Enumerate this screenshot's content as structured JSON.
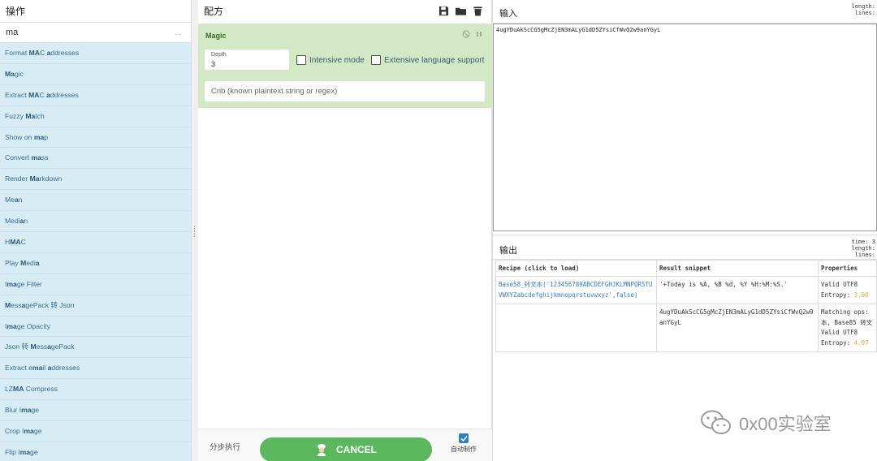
{
  "operations": {
    "title": "操作",
    "search_value": "ma",
    "search_dots": ". .",
    "items": [
      {
        "pre": "Format ",
        "hl": "MA",
        "mid": "C ",
        "hl2": "a",
        "post": "ddresses"
      },
      {
        "pre": "",
        "hl": "Ma",
        "mid": "gic",
        "hl2": "",
        "post": ""
      },
      {
        "pre": "Extract ",
        "hl": "MA",
        "mid": "C ",
        "hl2": "a",
        "post": "ddresses"
      },
      {
        "pre": "Fuzzy ",
        "hl": "Ma",
        "mid": "tch",
        "hl2": "",
        "post": ""
      },
      {
        "pre": "Show on ",
        "hl": "ma",
        "mid": "p",
        "hl2": "",
        "post": ""
      },
      {
        "pre": "Convert ",
        "hl": "ma",
        "mid": "ss",
        "hl2": "",
        "post": ""
      },
      {
        "pre": "Render ",
        "hl": "Ma",
        "mid": "rkdown",
        "hl2": "",
        "post": ""
      },
      {
        "pre": "Me",
        "hl": "a",
        "mid": "n",
        "hl2": "",
        "post": ""
      },
      {
        "pre": "Medi",
        "hl": "a",
        "mid": "n",
        "hl2": "",
        "post": ""
      },
      {
        "pre": "H",
        "hl": "MA",
        "mid": "C",
        "hl2": "",
        "post": ""
      },
      {
        "pre": "Play ",
        "hl": "M",
        "mid": "edi",
        "hl2": "a",
        "post": ""
      },
      {
        "pre": "I",
        "hl": "m",
        "mid": "",
        "hl2": "a",
        "post": "ge Filter"
      },
      {
        "pre": "",
        "hl": "M",
        "mid": "ess",
        "hl2": "a",
        "post": "gePack 转 Json"
      },
      {
        "pre": "I",
        "hl": "m",
        "mid": "",
        "hl2": "a",
        "post": "ge Opacity"
      },
      {
        "pre": "Json 转 ",
        "hl": "M",
        "mid": "ess",
        "hl2": "a",
        "post": "gePack"
      },
      {
        "pre": "Extract e",
        "hl": "ma",
        "mid": "il ",
        "hl2": "a",
        "post": "ddresses"
      },
      {
        "pre": "LZ",
        "hl": "MA",
        "mid": " Compress",
        "hl2": "",
        "post": ""
      },
      {
        "pre": "Blur I",
        "hl": "ma",
        "mid": "ge",
        "hl2": "",
        "post": ""
      },
      {
        "pre": "Crop I",
        "hl": "ma",
        "mid": "ge",
        "hl2": "",
        "post": ""
      },
      {
        "pre": "Flip I",
        "hl": "ma",
        "mid": "ge",
        "hl2": "",
        "post": ""
      }
    ]
  },
  "recipe": {
    "title": "配方",
    "icons": [
      "save-icon",
      "folder-icon",
      "trash-icon"
    ],
    "magic": {
      "name": "Magic",
      "depth_label": "Depth",
      "depth_value": "3",
      "intensive_label": "Intensive mode",
      "extensive_label": "Extensive language support",
      "crib_placeholder": "Crib (known plaintext string or regex)"
    },
    "footer": {
      "step_label": "分步执行",
      "cancel_label": "CANCEL",
      "autobake_label": "自动制作"
    }
  },
  "input": {
    "title": "输入",
    "stats": [
      "length:",
      "lines:"
    ],
    "text": "4ugYDuAkScCG5gMcZjEN3mALyG1dD5ZYsiCfWvQ2w9anYGyL"
  },
  "output": {
    "title": "输出",
    "stats": [
      "time: 3",
      "length:",
      "lines:"
    ],
    "headers": [
      "Recipe (click to load)",
      "Result snippet",
      "Properties"
    ],
    "rows": [
      {
        "recipe": "Base58_转文本('123456789ABCDEFGHJKLMNPQRSTUVWXYZabcdefghijkmnopqrstuvwxyz',false)",
        "snippet": "'+Today is %A, %B %d, %Y %H:%M:%S.'",
        "props": [
          "Valid UTF8",
          "Entropy: "
        ],
        "entropy": "3.90"
      },
      {
        "recipe": "",
        "snippet": "4ugYDuAkScCG5gMcZjEN3mALyG1dD5ZYsiCfWvQ2w9anYGyL",
        "props": [
          "Matching ops: ",
          "本, Base85 转文",
          "Valid UTF8",
          "Entropy: "
        ],
        "entropy": "4.97"
      }
    ]
  },
  "watermark": {
    "text": "0x00实验室",
    "icon": "wechat-icon"
  },
  "colors": {
    "ops_bg": "#d8ecf6",
    "magic_bg": "#d3e8c4",
    "cancel_bg": "#5cb85c",
    "entropy": "#f0a030",
    "link": "#2a7fce"
  }
}
